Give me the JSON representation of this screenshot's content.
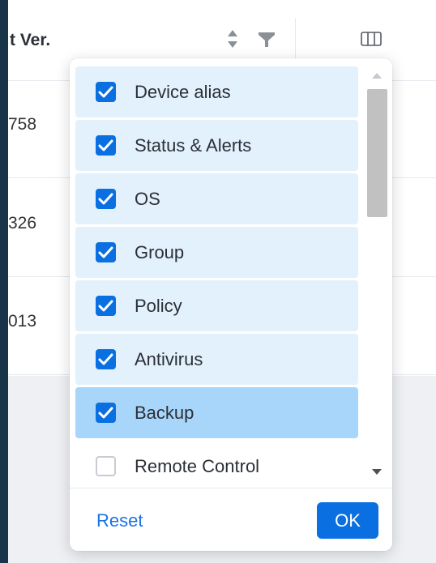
{
  "table": {
    "column_header": "t Ver.",
    "rows": [
      "758",
      "326",
      "013"
    ]
  },
  "icons": {
    "sort": "sort-icon",
    "filter": "filter-icon",
    "columns": "columns-icon",
    "checkmark": "checkmark-icon",
    "scroll_up": "scroll-up-arrow-icon",
    "scroll_down": "scroll-down-arrow-icon"
  },
  "column_picker": {
    "items": [
      {
        "label": "Device alias",
        "checked": true
      },
      {
        "label": "Status & Alerts",
        "checked": true
      },
      {
        "label": "OS",
        "checked": true
      },
      {
        "label": "Group",
        "checked": true
      },
      {
        "label": "Policy",
        "checked": true
      },
      {
        "label": "Antivirus",
        "checked": true
      },
      {
        "label": "Backup",
        "checked": true,
        "hovered": true
      },
      {
        "label": "Remote Control",
        "checked": false
      }
    ],
    "reset_label": "Reset",
    "ok_label": "OK"
  },
  "colors": {
    "accent": "#0a6fe0",
    "item_bg": "#e3f1fd",
    "item_hover_bg": "#a8d6fb",
    "sidebar": "#173448"
  }
}
